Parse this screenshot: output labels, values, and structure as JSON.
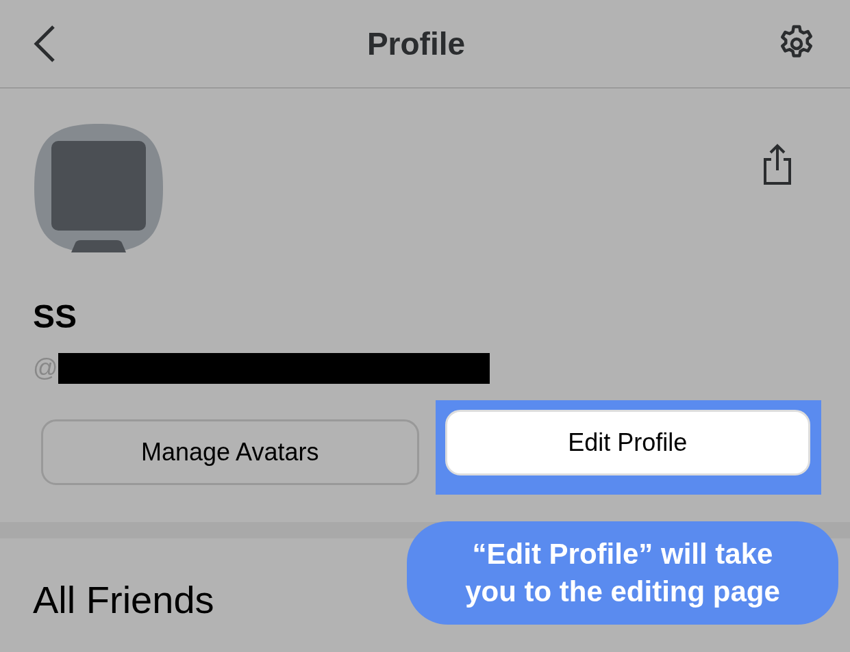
{
  "header": {
    "title": "Profile"
  },
  "profile": {
    "name": "SS",
    "handle_prefix": "@",
    "handle_redacted": true
  },
  "buttons": [
    {
      "label": "Manage Avatars",
      "highlighted": false
    },
    {
      "label": "Edit Profile",
      "highlighted": true
    }
  ],
  "section_title": "All Friends",
  "callout": {
    "text": "“Edit Profile” will take you to the editing page"
  }
}
